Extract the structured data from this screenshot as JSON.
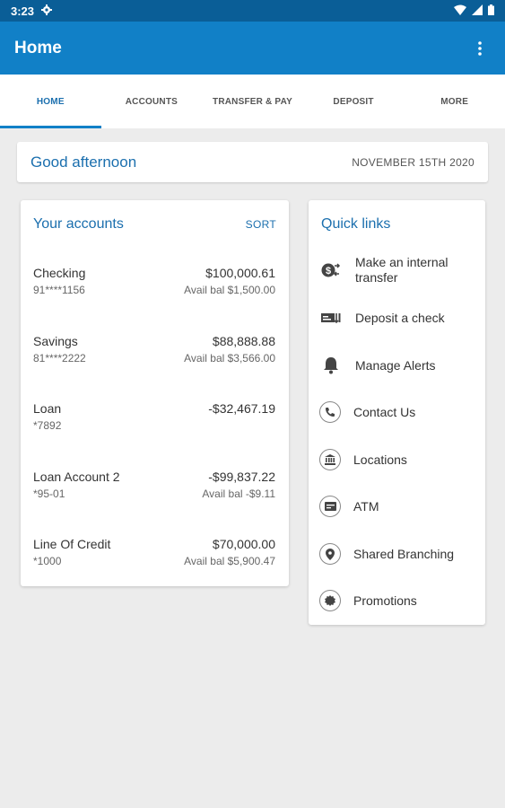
{
  "status": {
    "time": "3:23"
  },
  "appbar": {
    "title": "Home"
  },
  "tabs": [
    {
      "label": "HOME"
    },
    {
      "label": "ACCOUNTS"
    },
    {
      "label": "TRANSFER & PAY"
    },
    {
      "label": "DEPOSIT"
    },
    {
      "label": "MORE"
    }
  ],
  "greeting": {
    "text": "Good afternoon",
    "date": "NOVEMBER 15TH 2020"
  },
  "accounts": {
    "title": "Your accounts",
    "sort_label": "SORT",
    "items": [
      {
        "name": "Checking",
        "number": "91****1156",
        "amount": "$100,000.61",
        "avail": "Avail bal $1,500.00"
      },
      {
        "name": "Savings",
        "number": "81****2222",
        "amount": "$88,888.88",
        "avail": "Avail bal $3,566.00"
      },
      {
        "name": "Loan",
        "number": "*7892",
        "amount": "-$32,467.19",
        "avail": ""
      },
      {
        "name": "Loan Account 2",
        "number": "*95-01",
        "amount": "-$99,837.22",
        "avail": "Avail bal -$9.11"
      },
      {
        "name": "Line Of Credit",
        "number": "*1000",
        "amount": "$70,000.00",
        "avail": "Avail bal $5,900.47"
      }
    ]
  },
  "quick_links": {
    "title": "Quick links",
    "items": [
      {
        "label": "Make an internal transfer",
        "icon": "transfer-icon"
      },
      {
        "label": "Deposit a check",
        "icon": "check-deposit-icon"
      },
      {
        "label": "Manage Alerts",
        "icon": "bell-icon"
      },
      {
        "label": "Contact Us",
        "icon": "phone-icon"
      },
      {
        "label": "Locations",
        "icon": "bank-icon"
      },
      {
        "label": "ATM",
        "icon": "atm-icon"
      },
      {
        "label": "Shared Branching",
        "icon": "location-pin-icon"
      },
      {
        "label": "Promotions",
        "icon": "promotions-icon"
      }
    ]
  },
  "colors": {
    "appbar": "#1180c7",
    "statusbar": "#0a5e97",
    "accent": "#1b6fae",
    "background": "#ececec"
  }
}
